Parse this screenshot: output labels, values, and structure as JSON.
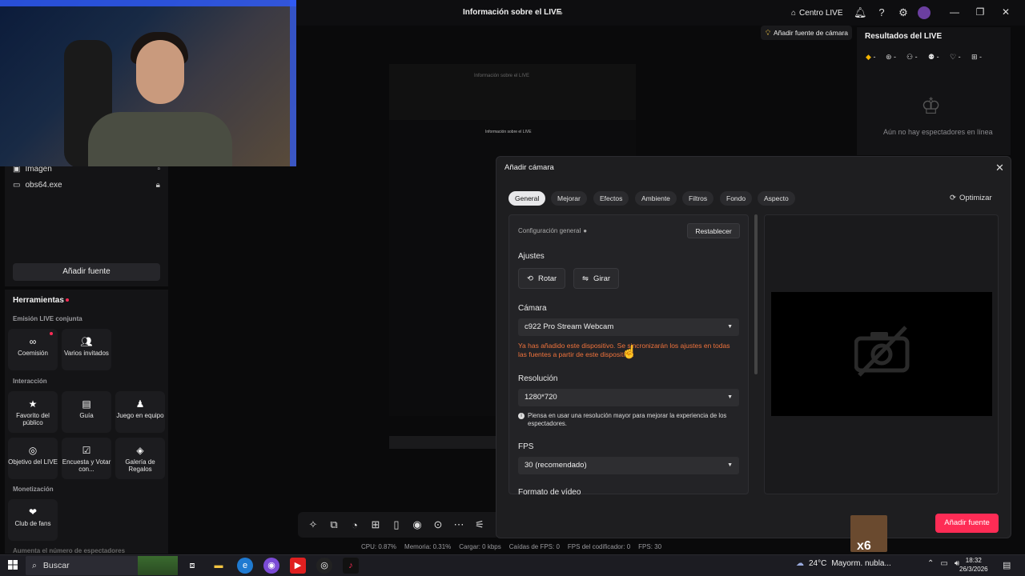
{
  "window": {
    "title": "Información sobre el LIVE",
    "centro_live": "Centro LIVE",
    "tip": "Añadir fuente de cámara"
  },
  "sources": {
    "items": [
      {
        "label": "Imagen",
        "icon": "image-icon"
      },
      {
        "label": "obs64.exe",
        "icon": "window-icon"
      }
    ],
    "add_label": "Añadir fuente"
  },
  "tools": {
    "title": "Herramientas",
    "sections": {
      "cohost": "Emisión LIVE conjunta",
      "interaction": "Interacción",
      "monetization": "Monetización",
      "more": "Aumenta el número de espectadores"
    },
    "cohost_items": [
      {
        "label": "Coemisión",
        "icon": "link-icon"
      },
      {
        "label": "Varios invitados",
        "icon": "guests-icon"
      }
    ],
    "interaction_items": [
      {
        "label": "Favorito del público",
        "icon": "favorite-icon"
      },
      {
        "label": "Guía",
        "icon": "guide-icon"
      },
      {
        "label": "Juego en equipo",
        "icon": "team-game-icon"
      },
      {
        "label": "Objetivo del LIVE",
        "icon": "target-icon"
      },
      {
        "label": "Encuesta y Votar con...",
        "icon": "poll-icon"
      },
      {
        "label": "Galería de Regalos",
        "icon": "gift-gallery-icon"
      }
    ],
    "monetization_items": [
      {
        "label": "Club de fans",
        "icon": "fan-club-icon"
      }
    ]
  },
  "preview": {
    "title_small": "Información sobre el LIVE",
    "title_tiny": "Información sobre el LIVE"
  },
  "stats": {
    "cpu": "CPU: 0.87%",
    "memory": "Memoria: 0.31%",
    "upload": "Cargar: 0 kbps",
    "fps_drops": "Caídas de FPS: 0",
    "encoder_fps": "FPS del codificador: 0",
    "fps": "FPS: 30"
  },
  "results": {
    "title": "Resultados del LIVE",
    "empty": "Aún no hay espectadores en línea",
    "metric_values": [
      "-",
      "-",
      "-",
      "-",
      "-",
      "-"
    ]
  },
  "modal": {
    "title": "Añadir cámara",
    "tabs": [
      "General",
      "Mejorar",
      "Efectos",
      "Ambiente",
      "Filtros",
      "Fondo",
      "Aspecto"
    ],
    "optimize": "Optimizar",
    "config_label": "Configuración general",
    "reset": "Restablecer",
    "adjustments_label": "Ajustes",
    "rotate": "Rotar",
    "flip": "Girar",
    "camera_label": "Cámara",
    "camera_value": "c922 Pro Stream Webcam",
    "warning": "Ya has añadido este dispositivo. Se sincronizarán los ajustes en todas las fuentes a partir de este dispositivo.",
    "resolution_label": "Resolución",
    "resolution_value": "1280*720",
    "resolution_note": "Piensa en usar una resolución mayor para mejorar la experiencia de los espectadores.",
    "fps_label": "FPS",
    "fps_value": "30 (recomendado)",
    "format_label": "Formato de vídeo",
    "add_button": "Añadir fuente"
  },
  "meme": {
    "text": "x6"
  },
  "taskbar": {
    "search": "Buscar",
    "weather_temp": "24°C",
    "weather_desc": "Mayorm. nubla...",
    "time": "18:32",
    "date": "26/3/2026"
  }
}
